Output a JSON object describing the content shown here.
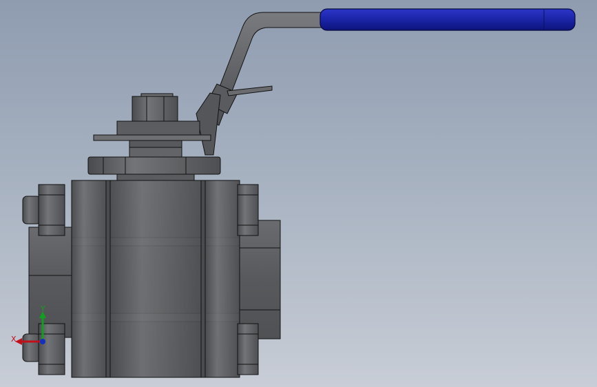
{
  "viewport": {
    "background_top": "#8f9cb0",
    "background_bottom": "#c8cdd6"
  },
  "model": {
    "name": "ball-valve",
    "handle_grip_color": "#1520a0",
    "body_color": "#5f6063",
    "highlight_color": "#8a8b8e",
    "edge_color": "#111111"
  },
  "triad": {
    "x_label": "X",
    "y_label": "Y",
    "x_color": "#c0101a",
    "y_color": "#10a020",
    "z_color": "#1030c0"
  }
}
